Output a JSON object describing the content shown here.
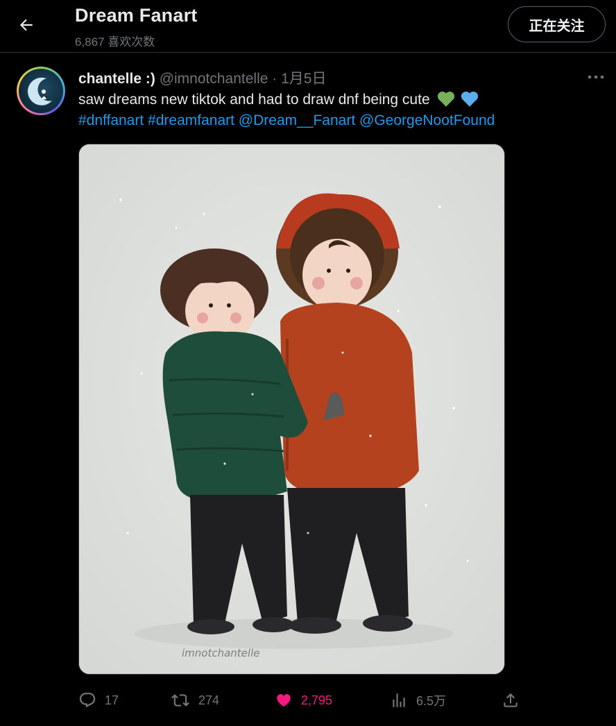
{
  "header": {
    "title": "Dream Fanart",
    "likes_count": "6,867 喜欢次数",
    "follow_label": "正在关注"
  },
  "tweet": {
    "display_name": "chantelle :)",
    "handle": "@imnotchantelle",
    "date": "· 1月5日",
    "text_line1": "saw dreams new tiktok and had to draw dnf being cute",
    "emojis": [
      "green-heart",
      "blue-heart"
    ],
    "hashtags": [
      "#dnffanart",
      "#dreamfanart"
    ],
    "mentions": [
      "@Dream__Fanart",
      "@GeorgeNootFound"
    ],
    "image_signature": "imnotchantelle",
    "stats": {
      "replies": "17",
      "retweets": "274",
      "likes": "2,795",
      "views": "6.5万"
    }
  },
  "colors": {
    "accent": "#1d9bf0",
    "like": "#f91880",
    "muted": "#71767b",
    "background": "#000000"
  }
}
